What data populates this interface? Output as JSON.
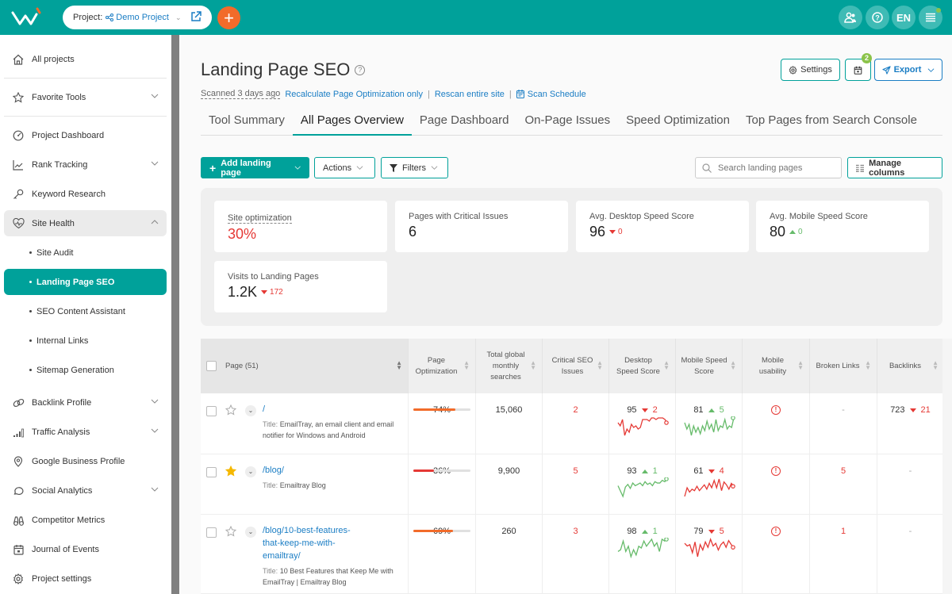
{
  "topbar": {
    "project_label": "Project:",
    "project_name": "Demo Project",
    "lang": "EN"
  },
  "sidebar": {
    "items": [
      {
        "label": "All projects",
        "icon": "home-icon"
      },
      {
        "label": "Favorite Tools",
        "icon": "star-icon",
        "chevron": "down"
      },
      {
        "label": "Project Dashboard",
        "icon": "gauge-icon"
      },
      {
        "label": "Rank Tracking",
        "icon": "chart-line-icon",
        "chevron": "down"
      },
      {
        "label": "Keyword Research",
        "icon": "key-icon"
      },
      {
        "label": "Site Health",
        "icon": "heart-pulse-icon",
        "chevron": "up"
      },
      {
        "label": "Site Audit",
        "sub": true
      },
      {
        "label": "Landing Page SEO",
        "sub": true,
        "active": true
      },
      {
        "label": "SEO Content Assistant",
        "sub": true
      },
      {
        "label": "Internal Links",
        "sub": true
      },
      {
        "label": "Sitemap Generation",
        "sub": true
      },
      {
        "label": "Backlink Profile",
        "icon": "link-icon",
        "chevron": "down"
      },
      {
        "label": "Traffic Analysis",
        "icon": "signal-icon",
        "chevron": "down"
      },
      {
        "label": "Google Business Profile",
        "icon": "map-pin-icon"
      },
      {
        "label": "Social Analytics",
        "icon": "chat-bubble-icon",
        "chevron": "down"
      },
      {
        "label": "Competitor Metrics",
        "icon": "binoculars-icon"
      },
      {
        "label": "Journal of Events",
        "icon": "calendar-icon"
      },
      {
        "label": "Project settings",
        "icon": "gear-icon"
      }
    ]
  },
  "header": {
    "title": "Landing Page SEO",
    "scanned": "Scanned 3 days ago",
    "recalc": "Recalculate Page Optimization only",
    "rescan": "Rescan entire site",
    "schedule": "Scan Schedule",
    "settings": "Settings",
    "calendar_badge": "2",
    "export": "Export"
  },
  "tabs": [
    "Tool Summary",
    "All Pages Overview",
    "Page Dashboard",
    "On-Page Issues",
    "Speed Optimization",
    "Top Pages from Search Console"
  ],
  "active_tab": "All Pages Overview",
  "toolbar": {
    "add": "Add landing page",
    "actions": "Actions",
    "filters": "Filters",
    "search_placeholder": "Search landing pages",
    "manage": "Manage columns"
  },
  "summary": {
    "site_opt": {
      "label": "Site optimization",
      "value": "30%"
    },
    "critical": {
      "label": "Pages with Critical Issues",
      "value": "6"
    },
    "desktop": {
      "label": "Avg. Desktop Speed Score",
      "value": "96",
      "delta": "0",
      "dir": "down"
    },
    "mobile": {
      "label": "Avg. Mobile Speed Score",
      "value": "80",
      "delta": "0",
      "dir": "up"
    },
    "visits": {
      "label": "Visits to Landing Pages",
      "value": "1.2K",
      "delta": "172",
      "dir": "down"
    }
  },
  "table": {
    "headers": {
      "page": "Page (51)",
      "opt": "Page Optimization",
      "searches": "Total global monthly searches",
      "critical": "Critical SEO Issues",
      "desktop": "Desktop Speed Score",
      "mobile": "Mobile Speed Score",
      "usability": "Mobile usability",
      "broken": "Broken Links",
      "backlinks": "Backlinks"
    },
    "rows": [
      {
        "url": "/",
        "title_label": "Title:",
        "title": "EmailTray, an email client and email notifier for Windows and Android",
        "favorite": false,
        "opt": "74%",
        "opt_value": 74,
        "opt_color": "#f26b2a",
        "searches": "15,060",
        "critical": "2",
        "desktop": "95",
        "desktop_delta": "2",
        "desktop_dir": "down",
        "desktop_spark": [
          6,
          8,
          4,
          14,
          10,
          12,
          7,
          9,
          8,
          10,
          9,
          4,
          4,
          4,
          5,
          3,
          3,
          4,
          3,
          3,
          3,
          4,
          6
        ],
        "mobile": "81",
        "mobile_delta": "5",
        "mobile_dir": "up",
        "mobile_spark": [
          6,
          10,
          7,
          14,
          8,
          12,
          9,
          13,
          8,
          11,
          5,
          10,
          7,
          12,
          4,
          11,
          8,
          9,
          4,
          10,
          8,
          9,
          3
        ],
        "usability": "!",
        "broken": "-",
        "backlinks": "723",
        "backlinks_delta": "21",
        "backlinks_dir": "down"
      },
      {
        "url": "/blog/",
        "title_label": "Title:",
        "title": "Emailtray Blog",
        "favorite": true,
        "opt": "36%",
        "opt_value": 36,
        "opt_color": "#e53935",
        "searches": "9,900",
        "critical": "5",
        "desktop": "93",
        "desktop_delta": "1",
        "desktop_dir": "up",
        "desktop_spark": [
          8,
          12,
          16,
          9,
          7,
          10,
          6,
          8,
          7,
          6,
          8,
          5,
          7,
          6,
          8,
          5,
          6,
          6,
          4,
          5,
          3
        ],
        "mobile": "61",
        "mobile_delta": "4",
        "mobile_dir": "down",
        "mobile_spark": [
          14,
          8,
          11,
          9,
          10,
          7,
          10,
          8,
          6,
          9,
          5,
          8,
          3,
          8,
          2,
          10,
          4,
          6,
          9,
          5,
          7
        ],
        "usability": "!",
        "broken": "5",
        "backlinks": "-"
      },
      {
        "url": "/blog/10-best-features-that-keep-me-with-emailtray/",
        "url_lines": [
          "/blog/10-best-features-",
          "that-keep-me-with-",
          "emailtray/"
        ],
        "title_label": "Title:",
        "title": "10 Best Features that Keep Me with EmailTray | Emailtray Blog",
        "favorite": false,
        "opt": "69%",
        "opt_value": 69,
        "opt_color": "#f26b2a",
        "searches": "260",
        "critical": "3",
        "desktop": "98",
        "desktop_delta": "1",
        "desktop_dir": "up",
        "desktop_spark": [
          10,
          9,
          4,
          10,
          7,
          13,
          9,
          12,
          7,
          8,
          4,
          7,
          5,
          3,
          7,
          5,
          10,
          3,
          4,
          3
        ],
        "mobile": "79",
        "mobile_delta": "5",
        "mobile_dir": "down",
        "mobile_spark": [
          5,
          7,
          6,
          12,
          4,
          15,
          6,
          10,
          4,
          8,
          2,
          7,
          5,
          10,
          6,
          4,
          8,
          3,
          6,
          8
        ],
        "usability": "!",
        "broken": "1",
        "backlinks": "-"
      }
    ]
  },
  "colors": {
    "brand": "#00a19a",
    "accent": "#f26b2a",
    "down": "#e53935",
    "up": "#66bb6a",
    "link": "#1a7dc4"
  }
}
